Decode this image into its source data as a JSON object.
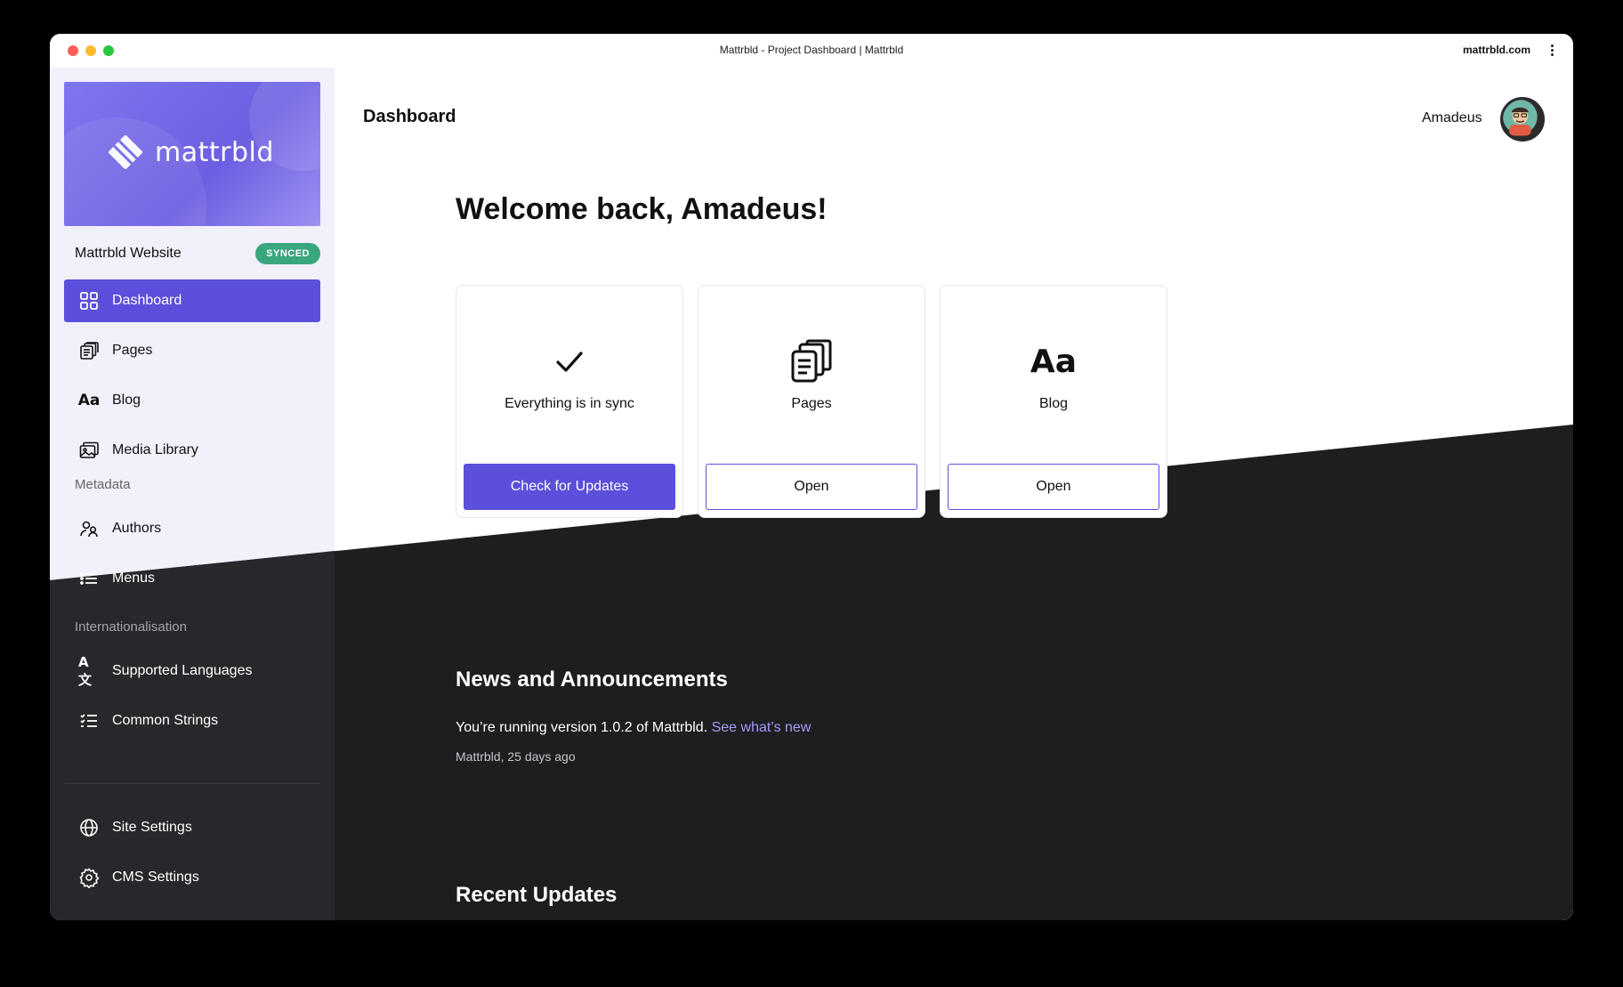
{
  "window": {
    "title": "Mattrbld - Project Dashboard | Mattrbld",
    "domain": "mattrbld.com"
  },
  "brand": {
    "name": "mattrbld"
  },
  "project": {
    "name": "Mattrbld Website",
    "status": "SYNCED"
  },
  "nav": {
    "main": [
      {
        "label": "Dashboard",
        "icon": "grid-icon",
        "active": true
      },
      {
        "label": "Pages",
        "icon": "pages-icon"
      },
      {
        "label": "Blog",
        "icon": "typography-icon"
      },
      {
        "label": "Media Library",
        "icon": "image-stack-icon"
      }
    ],
    "metadata_label": "Metadata",
    "metadata": [
      {
        "label": "Authors",
        "icon": "users-icon"
      },
      {
        "label": "Menus",
        "icon": "list-icon"
      }
    ],
    "i18n_label": "Internationalisation",
    "i18n": [
      {
        "label": "Supported Languages",
        "icon": "translate-icon"
      },
      {
        "label": "Common Strings",
        "icon": "checklist-icon"
      }
    ],
    "settings": [
      {
        "label": "Site Settings",
        "icon": "globe-icon"
      },
      {
        "label": "CMS Settings",
        "icon": "gear-icon"
      }
    ]
  },
  "header": {
    "title": "Dashboard",
    "user": "Amadeus"
  },
  "welcome": "Welcome back, Amadeus!",
  "cards": [
    {
      "label": "Everything is in sync",
      "icon": "check-icon",
      "button": "Check for Updates"
    },
    {
      "label": "Pages",
      "icon": "pages-icon",
      "button": "Open"
    },
    {
      "label": "Blog",
      "icon": "typography-icon",
      "button": "Open"
    }
  ],
  "news": {
    "title": "News and Announcements",
    "text": "You’re running version 1.0.2 of Mattrbld.",
    "link": "See what’s new",
    "meta": "Mattrbld, 25 days ago"
  },
  "recent": {
    "title": "Recent Updates"
  },
  "colors": {
    "accent": "#5b4fdb",
    "synced": "#3aa67d",
    "dark": "#1e1e21",
    "sidebar": "#f1f0fb"
  }
}
